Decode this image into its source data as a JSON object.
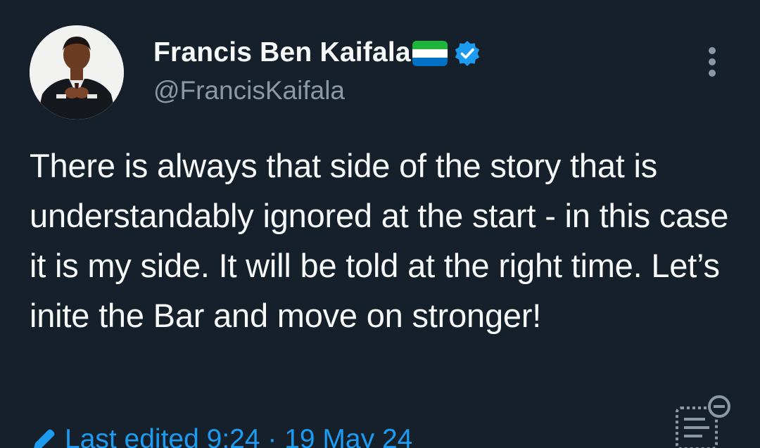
{
  "tweet": {
    "author": {
      "display_name": "Francis Ben Kaifala",
      "handle": "@FrancisKaifala",
      "flag": "sierra-leone-flag",
      "verified": true
    },
    "text": "There is always that side of the story that is understandably ignored at the start - in this case it is my side. It will be told at the right time. Let’s inite the Bar and move on stronger!",
    "edit_info": "Last edited 9:24 · 19 May 24"
  },
  "icons": {
    "more": "more-vertical-icon",
    "verified": "verified-badge-icon",
    "edited": "pencil-icon",
    "notes": "community-notes-icon"
  },
  "colors": {
    "background": "#15202b",
    "text_primary": "#f7f9f9",
    "text_secondary": "#8b98a5",
    "accent": "#1d9bf0"
  }
}
